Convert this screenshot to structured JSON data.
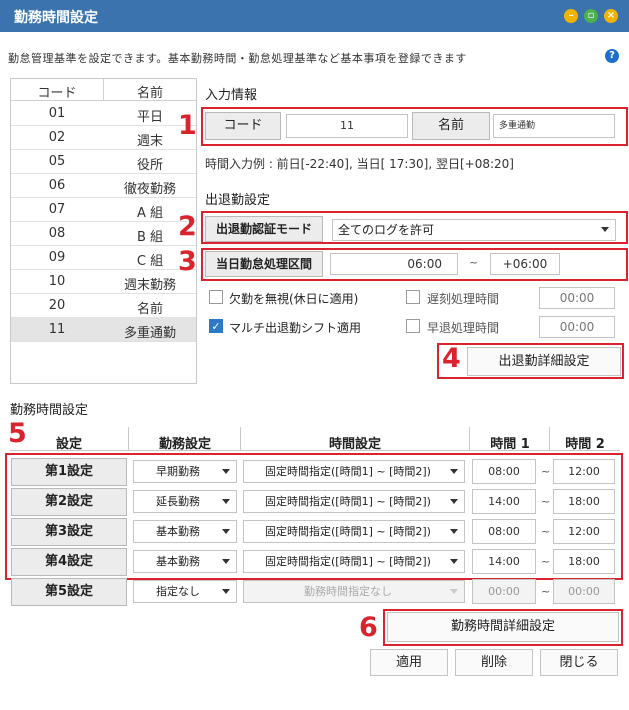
{
  "window": {
    "title": "勤務時間設定",
    "min_icon": "minimize-icon",
    "max_icon": "maximize-icon",
    "close_icon": "close-icon"
  },
  "description": "勤怠管理基準を設定できます。基本勤務時間・勤怠処理基準など基本事項を登録できます",
  "list": {
    "header_code": "コード",
    "header_name": "名前",
    "rows": [
      {
        "code": "01",
        "name": "平日"
      },
      {
        "code": "02",
        "name": "週末"
      },
      {
        "code": "05",
        "name": "役所"
      },
      {
        "code": "06",
        "name": "徹夜勤務"
      },
      {
        "code": "07",
        "name": "A 組"
      },
      {
        "code": "08",
        "name": "B 組"
      },
      {
        "code": "09",
        "name": "C 組"
      },
      {
        "code": "10",
        "name": "週末勤務"
      },
      {
        "code": "20",
        "name": "名前"
      },
      {
        "code": "11",
        "name": "多重通勤"
      }
    ],
    "selected_code": "11"
  },
  "input_info": {
    "section": "入力情報",
    "code_label": "コード",
    "code_value": "11",
    "name_label": "名前",
    "name_value": "多重通勤",
    "example": "時間入力例 : 前日[-22:40], 当日[ 17:30], 翌日[+08:20]"
  },
  "attendance": {
    "section": "出退勤設定",
    "auth_mode_label": "出退勤認証モード",
    "auth_mode_value": "全てのログを許可",
    "day_range_label": "当日勤怠処理区間",
    "range_start": "06:00",
    "range_sep": "~",
    "range_end": "+06:00",
    "ignore_absence_label": "欠勤を無視(休日に適用)",
    "ignore_absence_checked": false,
    "multi_shift_label": "マルチ出退勤シフト適用",
    "multi_shift_checked": true,
    "late_label": "遅刻処理時間",
    "late_value": "00:00",
    "late_checked": false,
    "early_label": "早退処理時間",
    "early_value": "00:00",
    "early_checked": false,
    "detail_button": "出退勤詳細設定"
  },
  "work_time": {
    "section": "勤務時間設定",
    "col_setting": "設定",
    "col_work": "勤務設定",
    "col_time": "時間設定",
    "col_t1": "時間 1",
    "col_t2": "時間 2",
    "sep": "~",
    "rows": [
      {
        "label": "第1設定",
        "work": "早期勤務",
        "time": "固定時間指定([時間1] ~ [時間2])",
        "t1": "08:00",
        "t2": "12:00",
        "disabled": false
      },
      {
        "label": "第2設定",
        "work": "延長勤務",
        "time": "固定時間指定([時間1] ~ [時間2])",
        "t1": "14:00",
        "t2": "18:00",
        "disabled": false
      },
      {
        "label": "第3設定",
        "work": "基本勤務",
        "time": "固定時間指定([時間1] ~ [時間2])",
        "t1": "08:00",
        "t2": "12:00",
        "disabled": false
      },
      {
        "label": "第4設定",
        "work": "基本勤務",
        "time": "固定時間指定([時間1] ~ [時間2])",
        "t1": "14:00",
        "t2": "18:00",
        "disabled": false
      },
      {
        "label": "第5設定",
        "work": "指定なし",
        "time": "勤務時間指定なし",
        "t1": "00:00",
        "t2": "00:00",
        "disabled": true
      }
    ],
    "detail_button": "勤務時間詳細設定"
  },
  "footer": {
    "apply": "適用",
    "delete": "削除",
    "close": "閉じる"
  },
  "callouts": [
    "1",
    "2",
    "3",
    "4",
    "5",
    "6"
  ],
  "colors": {
    "titlebar": "#3a73ad",
    "callout": "#d9232d",
    "minimize": "#f0b400",
    "maximize": "#4caf50",
    "close": "#f0b400"
  }
}
